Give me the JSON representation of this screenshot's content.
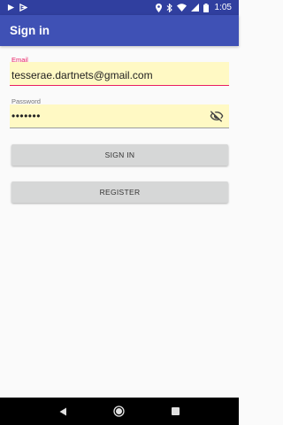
{
  "status_bar": {
    "time": "1:05"
  },
  "app_bar": {
    "title": "Sign in"
  },
  "form": {
    "email": {
      "label": "Email",
      "value": "tesserae.dartnets@gmail.com"
    },
    "password": {
      "label": "Password",
      "value": "•••••••"
    },
    "sign_in_label": "SIGN IN",
    "register_label": "REGISTER"
  },
  "colors": {
    "primary": "#3f51b5",
    "primary_dark": "#303f9f",
    "accent": "#e91e63",
    "field_bg": "#fff9c4",
    "button_bg": "#d6d7d7"
  },
  "icons": {
    "status_left": [
      "play-store-icon",
      "download-icon"
    ],
    "status_right": [
      "location-icon",
      "bluetooth-icon",
      "wifi-icon",
      "signal-icon",
      "battery-icon"
    ],
    "password_toggle": "visibility-off-icon",
    "nav": [
      "back-icon",
      "home-icon",
      "recents-icon"
    ]
  }
}
